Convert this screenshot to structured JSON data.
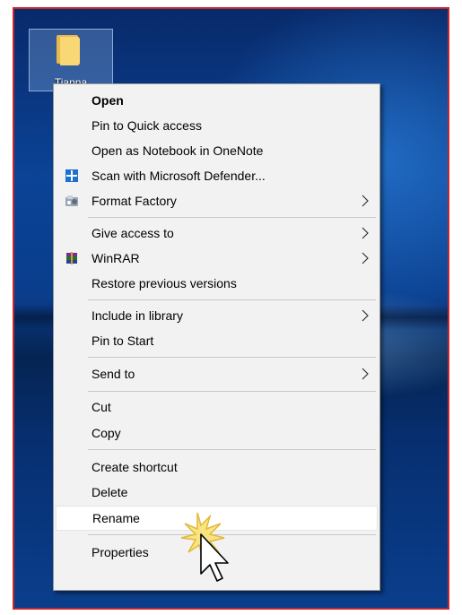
{
  "desktop": {
    "icon_label": "Tianna"
  },
  "menu": {
    "items": [
      {
        "label": "Open"
      },
      {
        "label": "Pin to Quick access"
      },
      {
        "label": "Open as Notebook in OneNote"
      },
      {
        "label": "Scan with Microsoft Defender..."
      },
      {
        "label": "Format Factory"
      },
      {
        "label": "Give access to"
      },
      {
        "label": "WinRAR"
      },
      {
        "label": "Restore previous versions"
      },
      {
        "label": "Include in library"
      },
      {
        "label": "Pin to Start"
      },
      {
        "label": "Send to"
      },
      {
        "label": "Cut"
      },
      {
        "label": "Copy"
      },
      {
        "label": "Create shortcut"
      },
      {
        "label": "Delete"
      },
      {
        "label": "Rename"
      },
      {
        "label": "Properties"
      }
    ],
    "highlighted": "Rename"
  },
  "icons": {
    "folder": "folder-icon",
    "defender": "shield-icon",
    "format_factory": "format-factory-icon",
    "winrar": "winrar-icon",
    "submenu": "chevron-right-icon",
    "cursor": "mouse-pointer-icon"
  },
  "colors": {
    "frame_border": "#c2282c",
    "menu_background": "#f2f2f2",
    "highlight": "#ffffff",
    "defender_blue": "#1d6fd0"
  }
}
